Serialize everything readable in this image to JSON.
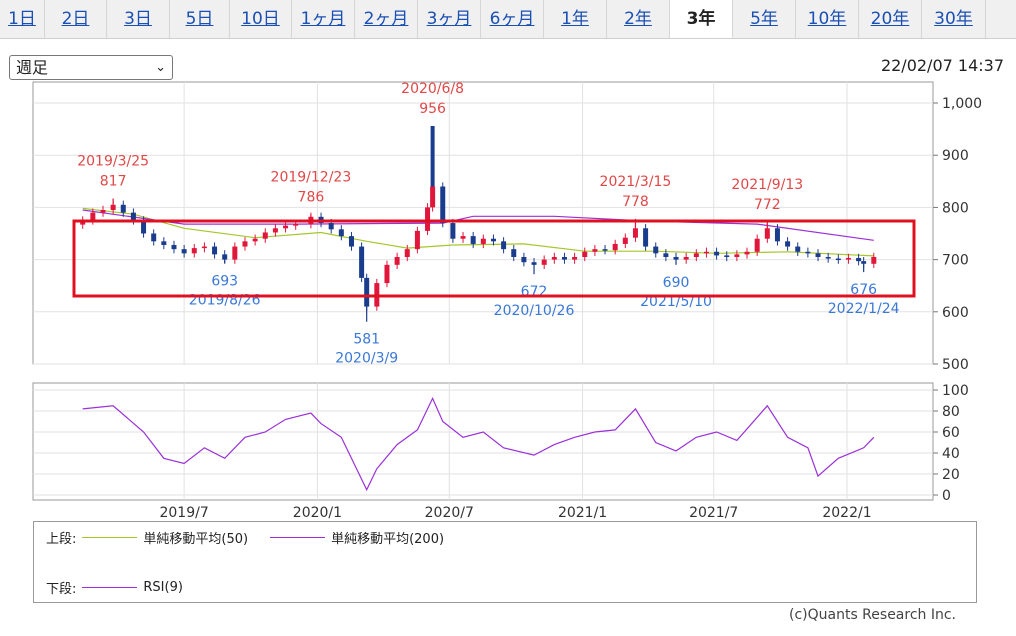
{
  "tabs": [
    {
      "label": "1日",
      "active": false
    },
    {
      "label": "2日",
      "active": false
    },
    {
      "label": "3日",
      "active": false
    },
    {
      "label": "5日",
      "active": false
    },
    {
      "label": "10日",
      "active": false
    },
    {
      "label": "1ヶ月",
      "active": false
    },
    {
      "label": "2ヶ月",
      "active": false
    },
    {
      "label": "3ヶ月",
      "active": false
    },
    {
      "label": "6ヶ月",
      "active": false
    },
    {
      "label": "1年",
      "active": false
    },
    {
      "label": "2年",
      "active": false
    },
    {
      "label": "3年",
      "active": true
    },
    {
      "label": "5年",
      "active": false
    },
    {
      "label": "10年",
      "active": false
    },
    {
      "label": "20年",
      "active": false
    },
    {
      "label": "30年",
      "active": false
    }
  ],
  "period_select": {
    "value": "週足",
    "icon": "chevron-down-icon"
  },
  "timestamp": "22/02/07 14:37",
  "colors": {
    "up": "#e0163a",
    "down": "#1a3c8c",
    "ma50": "#a6c62a",
    "ma200": "#9b30d9",
    "rsi": "#9b30d9",
    "annotation_high": "#e04848",
    "annotation_low": "#3a78d8",
    "highlight": "#e01020"
  },
  "chart_data": [
    {
      "type": "candlestick",
      "frequency": "weekly",
      "y_range": [
        500,
        1000
      ],
      "y_ticks": [
        "500",
        "600",
        "700",
        "800",
        "900",
        "1,000"
      ],
      "x_tick_labels": [
        "2019/7",
        "2020/1",
        "2020/7",
        "2021/1",
        "2021/7",
        "2022/1"
      ],
      "close_series": [
        [
          "2019-02-11",
          775
        ],
        [
          "2019-02-25",
          790
        ],
        [
          "2019-03-11",
          795
        ],
        [
          "2019-03-25",
          805
        ],
        [
          "2019-04-08",
          790
        ],
        [
          "2019-04-22",
          775
        ],
        [
          "2019-05-06",
          750
        ],
        [
          "2019-05-20",
          735
        ],
        [
          "2019-06-03",
          728
        ],
        [
          "2019-06-17",
          720
        ],
        [
          "2019-07-01",
          712
        ],
        [
          "2019-07-15",
          722
        ],
        [
          "2019-07-29",
          725
        ],
        [
          "2019-08-12",
          710
        ],
        [
          "2019-08-26",
          700
        ],
        [
          "2019-09-09",
          725
        ],
        [
          "2019-09-23",
          735
        ],
        [
          "2019-10-07",
          740
        ],
        [
          "2019-10-21",
          752
        ],
        [
          "2019-11-04",
          760
        ],
        [
          "2019-11-18",
          765
        ],
        [
          "2019-12-02",
          768
        ],
        [
          "2019-12-23",
          782
        ],
        [
          "2020-01-06",
          770
        ],
        [
          "2020-01-20",
          758
        ],
        [
          "2020-02-03",
          745
        ],
        [
          "2020-02-17",
          725
        ],
        [
          "2020-03-02",
          665
        ],
        [
          "2020-03-09",
          610
        ],
        [
          "2020-03-23",
          655
        ],
        [
          "2020-04-06",
          690
        ],
        [
          "2020-04-20",
          705
        ],
        [
          "2020-05-04",
          720
        ],
        [
          "2020-05-18",
          755
        ],
        [
          "2020-06-01",
          800
        ],
        [
          "2020-06-08",
          840
        ],
        [
          "2020-06-22",
          770
        ],
        [
          "2020-07-06",
          740
        ],
        [
          "2020-07-20",
          745
        ],
        [
          "2020-08-03",
          730
        ],
        [
          "2020-08-17",
          740
        ],
        [
          "2020-08-31",
          735
        ],
        [
          "2020-09-14",
          720
        ],
        [
          "2020-09-28",
          705
        ],
        [
          "2020-10-12",
          695
        ],
        [
          "2020-10-26",
          690
        ],
        [
          "2020-11-09",
          700
        ],
        [
          "2020-11-23",
          705
        ],
        [
          "2020-12-07",
          700
        ],
        [
          "2020-12-21",
          705
        ],
        [
          "2021-01-04",
          715
        ],
        [
          "2021-01-18",
          720
        ],
        [
          "2021-02-01",
          718
        ],
        [
          "2021-02-15",
          730
        ],
        [
          "2021-03-01",
          742
        ],
        [
          "2021-03-15",
          760
        ],
        [
          "2021-03-29",
          725
        ],
        [
          "2021-04-12",
          712
        ],
        [
          "2021-04-26",
          705
        ],
        [
          "2021-05-10",
          700
        ],
        [
          "2021-05-24",
          705
        ],
        [
          "2021-06-07",
          712
        ],
        [
          "2021-06-21",
          715
        ],
        [
          "2021-07-05",
          708
        ],
        [
          "2021-07-19",
          705
        ],
        [
          "2021-08-02",
          710
        ],
        [
          "2021-08-16",
          715
        ],
        [
          "2021-08-30",
          740
        ],
        [
          "2021-09-13",
          760
        ],
        [
          "2021-09-27",
          735
        ],
        [
          "2021-10-11",
          725
        ],
        [
          "2021-10-25",
          715
        ],
        [
          "2021-11-08",
          712
        ],
        [
          "2021-11-22",
          705
        ],
        [
          "2021-12-06",
          702
        ],
        [
          "2021-12-20",
          700
        ],
        [
          "2022-01-03",
          703
        ],
        [
          "2022-01-17",
          697
        ],
        [
          "2022-01-24",
          692
        ],
        [
          "2022-02-07",
          705
        ]
      ],
      "ma50": [
        [
          "2019-02-11",
          798
        ],
        [
          "2019-04-22",
          787
        ],
        [
          "2019-07-01",
          760
        ],
        [
          "2019-10-07",
          742
        ],
        [
          "2020-01-06",
          752
        ],
        [
          "2020-03-09",
          735
        ],
        [
          "2020-05-04",
          722
        ],
        [
          "2020-07-06",
          728
        ],
        [
          "2020-10-12",
          730
        ],
        [
          "2021-01-04",
          716
        ],
        [
          "2021-04-12",
          716
        ],
        [
          "2021-07-05",
          712
        ],
        [
          "2021-10-11",
          715
        ],
        [
          "2022-02-07",
          707
        ]
      ],
      "ma200": [
        [
          "2019-02-11",
          795
        ],
        [
          "2019-07-01",
          768
        ],
        [
          "2019-12-02",
          768
        ],
        [
          "2020-06-22",
          770
        ],
        [
          "2020-08-03",
          783
        ],
        [
          "2020-11-23",
          783
        ],
        [
          "2021-03-29",
          774
        ],
        [
          "2021-08-30",
          768
        ],
        [
          "2022-02-07",
          737
        ]
      ],
      "annotations": [
        {
          "kind": "high",
          "date": "2019/3/25",
          "price": "817",
          "x": "2019-03-25"
        },
        {
          "kind": "low",
          "date": "2019/8/26",
          "price": "693",
          "x": "2019-08-26"
        },
        {
          "kind": "high",
          "date": "2019/12/23",
          "price": "786",
          "x": "2019-12-23"
        },
        {
          "kind": "low",
          "date": "2020/3/9",
          "price": "581",
          "x": "2020-03-09"
        },
        {
          "kind": "high",
          "date": "2020/6/8",
          "price": "956",
          "x": "2020-06-08"
        },
        {
          "kind": "low",
          "date": "2020/10/26",
          "price": "672",
          "x": "2020-10-26"
        },
        {
          "kind": "high",
          "date": "2021/3/15",
          "price": "778",
          "x": "2021-03-15"
        },
        {
          "kind": "low",
          "date": "2021/5/10",
          "price": "690",
          "x": "2021-05-10"
        },
        {
          "kind": "high",
          "date": "2021/9/13",
          "price": "772",
          "x": "2021-09-13"
        },
        {
          "kind": "low",
          "date": "2022/1/24",
          "price": "676",
          "x": "2022-01-24"
        }
      ]
    },
    {
      "type": "line",
      "name": "RSI(9)",
      "y_range": [
        0,
        100
      ],
      "y_ticks": [
        "0",
        "20",
        "40",
        "60",
        "80",
        "100"
      ],
      "values": [
        [
          "2019-02-11",
          82
        ],
        [
          "2019-03-25",
          85
        ],
        [
          "2019-05-06",
          60
        ],
        [
          "2019-06-03",
          35
        ],
        [
          "2019-07-01",
          30
        ],
        [
          "2019-07-29",
          45
        ],
        [
          "2019-08-26",
          35
        ],
        [
          "2019-09-23",
          55
        ],
        [
          "2019-10-21",
          60
        ],
        [
          "2019-11-18",
          72
        ],
        [
          "2019-12-23",
          78
        ],
        [
          "2020-01-06",
          68
        ],
        [
          "2020-02-03",
          55
        ],
        [
          "2020-03-09",
          5
        ],
        [
          "2020-03-23",
          25
        ],
        [
          "2020-04-20",
          48
        ],
        [
          "2020-05-18",
          62
        ],
        [
          "2020-06-08",
          92
        ],
        [
          "2020-06-22",
          70
        ],
        [
          "2020-07-20",
          55
        ],
        [
          "2020-08-17",
          60
        ],
        [
          "2020-09-14",
          45
        ],
        [
          "2020-10-26",
          38
        ],
        [
          "2020-11-23",
          48
        ],
        [
          "2020-12-21",
          55
        ],
        [
          "2021-01-18",
          60
        ],
        [
          "2021-02-15",
          62
        ],
        [
          "2021-03-15",
          82
        ],
        [
          "2021-04-12",
          50
        ],
        [
          "2021-05-10",
          42
        ],
        [
          "2021-06-07",
          55
        ],
        [
          "2021-07-05",
          60
        ],
        [
          "2021-08-02",
          52
        ],
        [
          "2021-09-13",
          85
        ],
        [
          "2021-10-11",
          55
        ],
        [
          "2021-11-08",
          45
        ],
        [
          "2021-11-22",
          18
        ],
        [
          "2021-12-20",
          35
        ],
        [
          "2022-01-24",
          45
        ],
        [
          "2022-02-07",
          55
        ]
      ]
    }
  ],
  "legend": {
    "upper_label": "上段:",
    "items_upper": [
      {
        "label": "単純移動平均(50)",
        "color": "#a6c62a"
      },
      {
        "label": "単純移動平均(200)",
        "color": "#9b30d9"
      }
    ],
    "lower_label": "下段:",
    "items_lower": [
      {
        "label": "RSI(9)",
        "color": "#9b30d9"
      }
    ]
  },
  "copyright": "(c)Quants Research Inc."
}
